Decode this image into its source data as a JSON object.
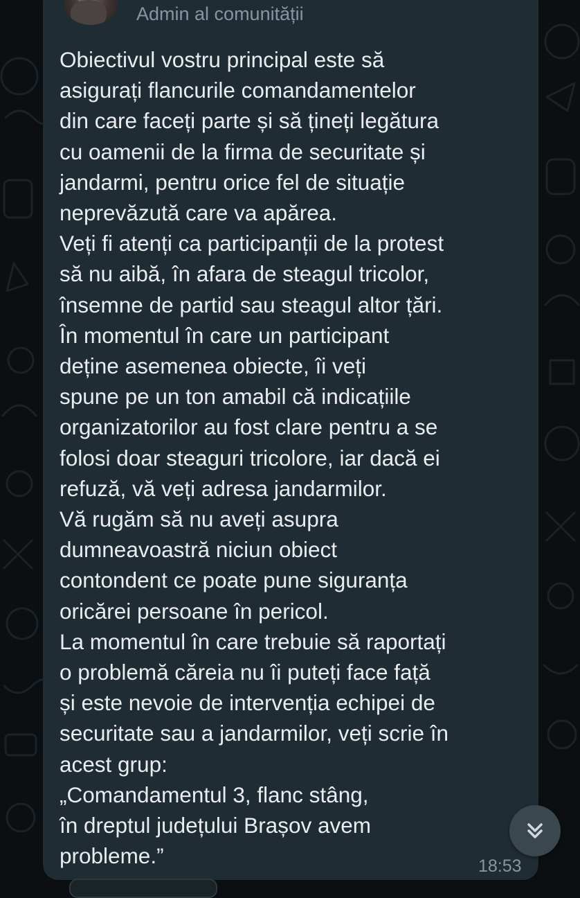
{
  "message": {
    "sender_role": "Admin al comunității",
    "lines": [
      "Obiectivul vostru principal este să",
      "asigurați flancurile comandamentelor",
      "din care faceți parte și să țineți legătura",
      "cu oamenii de la firma de securitate și",
      "jandarmi, pentru orice fel de situație",
      "neprevăzută care va apărea.",
      "Veți fi atenți ca participanții de la protest",
      "să nu aibă, în afara de steagul tricolor,",
      "însemne de partid sau steagul altor țări.",
      "În momentul în care un participant",
      "deține asemenea obiecte, îi veți",
      "spune pe un ton amabil că indicațiile",
      "organizatorilor au fost clare pentru a se",
      "folosi doar steaguri tricolore, iar dacă ei",
      "refuză, vă veți adresa jandarmilor.",
      "Vă rugăm să nu aveți asupra",
      "dumneavoastră niciun obiect",
      "contondent ce poate pune siguranța",
      "oricărei persoane în pericol.",
      "La momentul în care trebuie să raportați",
      "o problemă căreia nu îi puteți face față",
      "și este nevoie de intervenția echipei de",
      "securitate sau a jandarmilor, veți scrie în",
      "acest grup:",
      "„Comandamentul 3, flanc stâng,",
      "în dreptul județului Brașov avem",
      "probleme.”"
    ],
    "timestamp": "18:53"
  },
  "scroll_button": {
    "icon": "double-chevron-down-icon"
  },
  "colors": {
    "background": "#0b0f12",
    "bubble": "#202c33",
    "text": "#e9edef",
    "meta_text": "#8696a0",
    "scroll_button": "#3a474e"
  }
}
